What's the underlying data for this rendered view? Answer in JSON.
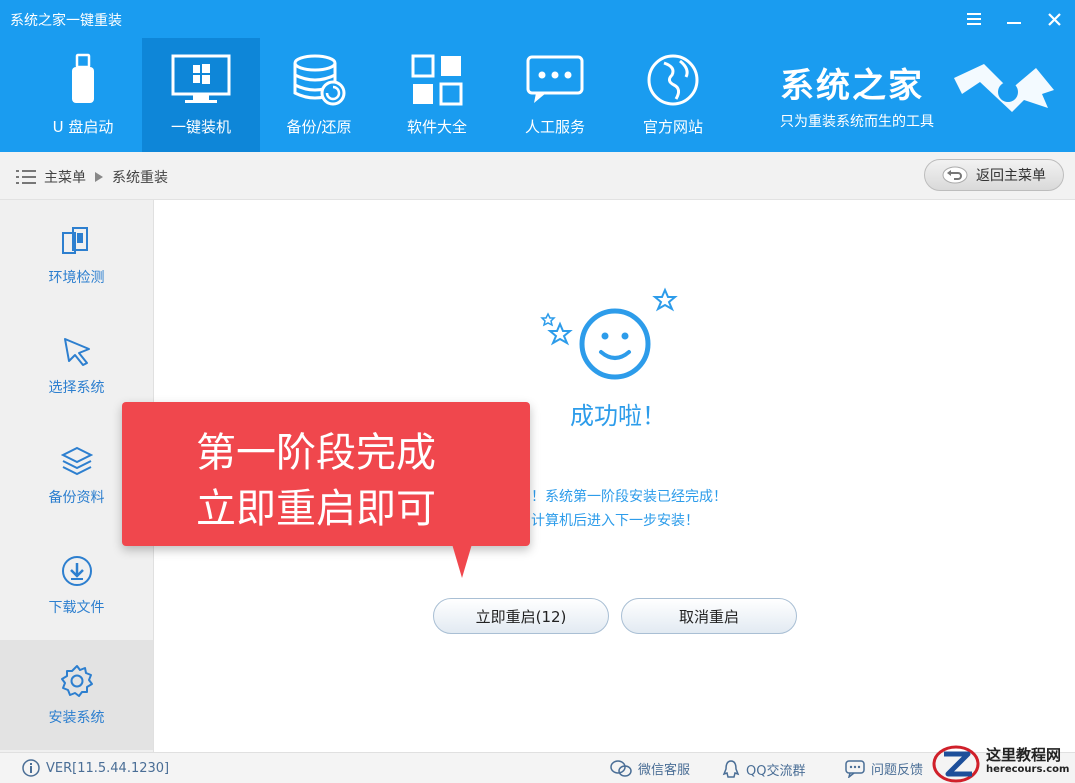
{
  "window": {
    "title": "系统之家一键重装",
    "menu_icon": "hamburger-icon",
    "minimize_icon": "minimize-icon",
    "close_icon": "close-icon"
  },
  "nav": {
    "items": [
      {
        "label": "U 盘启动",
        "icon": "usb-drive-icon"
      },
      {
        "label": "一键装机",
        "icon": "monitor-windows-icon",
        "active": true
      },
      {
        "label": "备份/还原",
        "icon": "database-restore-icon"
      },
      {
        "label": "软件大全",
        "icon": "apps-grid-icon"
      },
      {
        "label": "人工服务",
        "icon": "chat-bubble-icon"
      },
      {
        "label": "官方网站",
        "icon": "globe-icon"
      }
    ]
  },
  "brand": {
    "name": "系统之家",
    "slogan": "只为重装系统而生的工具"
  },
  "breadcrumb": {
    "root": "主菜单",
    "current": "系统重装",
    "back_label": "返回主菜单"
  },
  "sidebar": {
    "items": [
      {
        "label": "环境检测",
        "icon": "device-check-icon"
      },
      {
        "label": "选择系统",
        "icon": "cursor-icon"
      },
      {
        "label": "备份资料",
        "icon": "layers-icon"
      },
      {
        "label": "下载文件",
        "icon": "download-icon"
      },
      {
        "label": "安装系统",
        "icon": "gear-icon",
        "active": true
      }
    ]
  },
  "main": {
    "success_title": "成功啦！",
    "message_line1": "！系统第一阶段安装已经完成！",
    "message_line2": "计算机后进入下一步安装！",
    "restart_button": "立即重启(12)",
    "cancel_button": "取消重启"
  },
  "callout": {
    "line1": "第一阶段完成",
    "line2": "立即重启即可"
  },
  "footer": {
    "version": "VER[11.5.44.1230]",
    "wechat": "微信客服",
    "qq": "QQ交流群",
    "feedback": "问题反馈"
  },
  "watermark": {
    "title": "这里教程网",
    "url": "herecours.com"
  },
  "colors": {
    "header_blue": "#1a9cf0",
    "accent_blue": "#2d9cea",
    "callout_red": "#f0474d"
  }
}
